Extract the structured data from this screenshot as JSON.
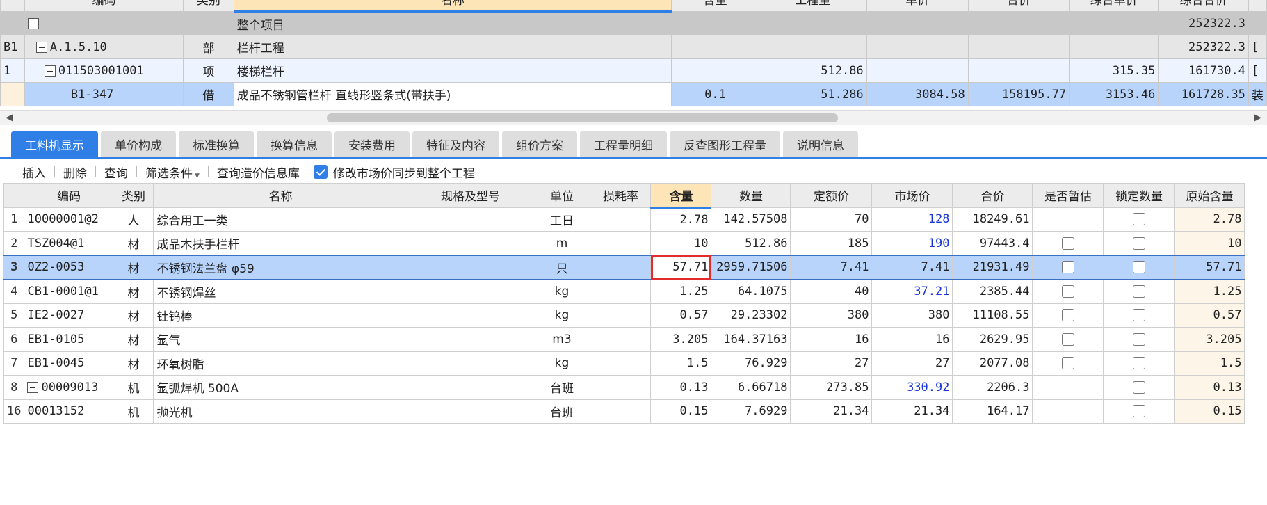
{
  "top_grid": {
    "headers": [
      "",
      "编码",
      "类别",
      "名称",
      "含量",
      "工程量",
      "单价",
      "合价",
      "综合单价",
      "综合合价",
      ""
    ],
    "rows": [
      {
        "idx": "",
        "code": "",
        "type": "",
        "name": "整个项目",
        "qty": "",
        "work": "",
        "price": "",
        "total": "",
        "comp_price": "",
        "comp_total": "252322.3",
        "extra": ""
      },
      {
        "idx": "B1",
        "code": "A.1.5.10",
        "type": "部",
        "name": "栏杆工程",
        "qty": "",
        "work": "",
        "price": "",
        "total": "",
        "comp_price": "",
        "comp_total": "252322.3",
        "extra": "["
      },
      {
        "idx": "1",
        "code": "011503001001",
        "type": "项",
        "name": "楼梯栏杆",
        "qty": "",
        "work": "512.86",
        "price": "",
        "total": "",
        "comp_price": "315.35",
        "comp_total": "161730.4",
        "extra": "["
      },
      {
        "idx": "",
        "code": "B1-347",
        "type": "借",
        "name": "成品不锈钢管栏杆 直线形竖条式(带扶手)",
        "qty": "0.1",
        "work": "51.286",
        "price": "3084.58",
        "total": "158195.77",
        "comp_price": "3153.46",
        "comp_total": "161728.35",
        "extra": "装"
      }
    ]
  },
  "tabs": [
    {
      "label": "工料机显示",
      "active": true
    },
    {
      "label": "单价构成",
      "active": false
    },
    {
      "label": "标准换算",
      "active": false
    },
    {
      "label": "换算信息",
      "active": false
    },
    {
      "label": "安装费用",
      "active": false
    },
    {
      "label": "特征及内容",
      "active": false
    },
    {
      "label": "组价方案",
      "active": false
    },
    {
      "label": "工程量明细",
      "active": false
    },
    {
      "label": "反查图形工程量",
      "active": false
    },
    {
      "label": "说明信息",
      "active": false
    }
  ],
  "toolbar": {
    "insert": "插入",
    "delete": "删除",
    "query": "查询",
    "filter": "筛选条件",
    "query_price_db": "查询造价信息库",
    "sync_label": "修改市场价同步到整个工程",
    "sync_checked": true
  },
  "bottom_grid": {
    "headers": [
      "",
      "编码",
      "类别",
      "名称",
      "规格及型号",
      "单位",
      "损耗率",
      "含量",
      "数量",
      "定额价",
      "市场价",
      "合价",
      "是否暂估",
      "锁定数量",
      "原始含量"
    ],
    "rows": [
      {
        "no": "1",
        "code": "10000001@2",
        "type": "人",
        "name": "综合用工一类",
        "spec": "",
        "unit": "工日",
        "loss": "",
        "content": "2.78",
        "amount": "142.57508",
        "quota": "70",
        "market": "128",
        "market_blue": true,
        "total": "18249.61",
        "tmp_box": false,
        "orig": "2.78"
      },
      {
        "no": "2",
        "code": "TSZ004@1",
        "type": "材",
        "name": "成品木扶手栏杆",
        "spec": "",
        "unit": "m",
        "loss": "",
        "content": "10",
        "amount": "512.86",
        "quota": "185",
        "market": "190",
        "market_blue": true,
        "total": "97443.4",
        "tmp_box": true,
        "orig": "10"
      },
      {
        "no": "3",
        "code": "0Z2-0053",
        "type": "材",
        "name": "不锈钢法兰盘 φ59",
        "spec": "",
        "unit": "只",
        "loss": "",
        "content": "57.71",
        "amount": "2959.71506",
        "quota": "7.41",
        "market": "7.41",
        "market_blue": false,
        "total": "21931.49",
        "tmp_box": true,
        "orig": "57.71",
        "selected": true
      },
      {
        "no": "4",
        "code": "CB1-0001@1",
        "type": "材",
        "name": "不锈钢焊丝",
        "spec": "",
        "unit": "kg",
        "loss": "",
        "content": "1.25",
        "amount": "64.1075",
        "quota": "40",
        "market": "37.21",
        "market_blue": true,
        "total": "2385.44",
        "tmp_box": true,
        "orig": "1.25"
      },
      {
        "no": "5",
        "code": "IE2-0027",
        "type": "材",
        "name": "钍钨棒",
        "spec": "",
        "unit": "kg",
        "loss": "",
        "content": "0.57",
        "amount": "29.23302",
        "quota": "380",
        "market": "380",
        "market_blue": false,
        "total": "11108.55",
        "tmp_box": true,
        "orig": "0.57"
      },
      {
        "no": "6",
        "code": "EB1-0105",
        "type": "材",
        "name": "氩气",
        "spec": "",
        "unit": "m3",
        "loss": "",
        "content": "3.205",
        "amount": "164.37163",
        "quota": "16",
        "market": "16",
        "market_blue": false,
        "total": "2629.95",
        "tmp_box": true,
        "orig": "3.205"
      },
      {
        "no": "7",
        "code": "EB1-0045",
        "type": "材",
        "name": "环氧树脂",
        "spec": "",
        "unit": "kg",
        "loss": "",
        "content": "1.5",
        "amount": "76.929",
        "quota": "27",
        "market": "27",
        "market_blue": false,
        "total": "2077.08",
        "tmp_box": true,
        "orig": "1.5"
      },
      {
        "no": "8",
        "code": "00009013",
        "type": "机",
        "name": "氩弧焊机 500A",
        "spec": "",
        "unit": "台班",
        "loss": "",
        "content": "0.13",
        "amount": "6.66718",
        "quota": "273.85",
        "market": "330.92",
        "market_blue": true,
        "total": "2206.3",
        "tmp_box": false,
        "orig": "0.13",
        "expand": true
      },
      {
        "no": "16",
        "code": "00013152",
        "type": "机",
        "name": "抛光机",
        "spec": "",
        "unit": "台班",
        "loss": "",
        "content": "0.15",
        "amount": "7.6929",
        "quota": "21.34",
        "market": "21.34",
        "market_blue": false,
        "total": "164.17",
        "tmp_box": false,
        "orig": "0.15"
      }
    ]
  }
}
